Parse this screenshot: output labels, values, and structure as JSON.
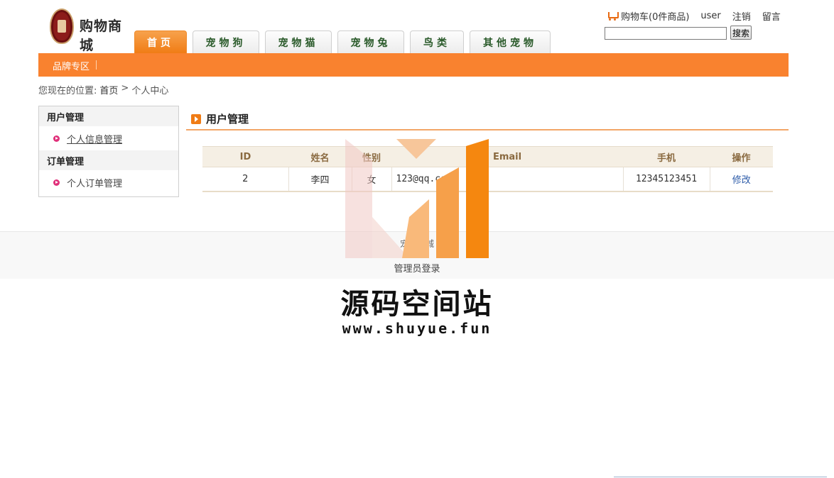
{
  "header": {
    "logo_text": "购物商城",
    "tabs": [
      {
        "label": "首页",
        "active": true
      },
      {
        "label": "宠物狗",
        "active": false
      },
      {
        "label": "宠物猫",
        "active": false
      },
      {
        "label": "宠物兔",
        "active": false
      },
      {
        "label": "鸟类",
        "active": false
      },
      {
        "label": "其他宠物",
        "active": false
      }
    ],
    "cart_label": "购物车(0件商品)",
    "username": "user",
    "logout_label": "注销",
    "message_label": "留言",
    "search": {
      "placeholder": "",
      "value": "",
      "button_label": "搜索"
    }
  },
  "nav_bar": {
    "brand_zone_label": "品牌专区",
    "color": "#f9822f"
  },
  "breadcrumb": {
    "prefix": "您现在的位置:",
    "home": "首页",
    "separator": ">",
    "current": "个人中心"
  },
  "sidebar": {
    "sections": [
      {
        "title": "用户管理",
        "items": [
          {
            "label": "个人信息管理",
            "current": true
          }
        ]
      },
      {
        "title": "订单管理",
        "items": [
          {
            "label": "个人订单管理",
            "current": false
          }
        ]
      }
    ]
  },
  "main": {
    "title": "用户管理",
    "table": {
      "headers": [
        "ID",
        "姓名",
        "性别",
        "Email",
        "手机",
        "操作"
      ],
      "rows": [
        {
          "id": "2",
          "name": "李四",
          "gender": "女",
          "email": "123@qq.com",
          "phone": "12345123451",
          "action": "修改"
        }
      ]
    }
  },
  "footer": {
    "line1": "宠物商城",
    "admin_login": "管理员登录"
  },
  "watermark": {
    "title": "源码空间站",
    "url": "www.shuyue.fun",
    "icon": "bar-logo-icon"
  },
  "colors": {
    "accent": "#f9822f",
    "tab_active": "#f07c15",
    "link": "#2b5aa8"
  }
}
